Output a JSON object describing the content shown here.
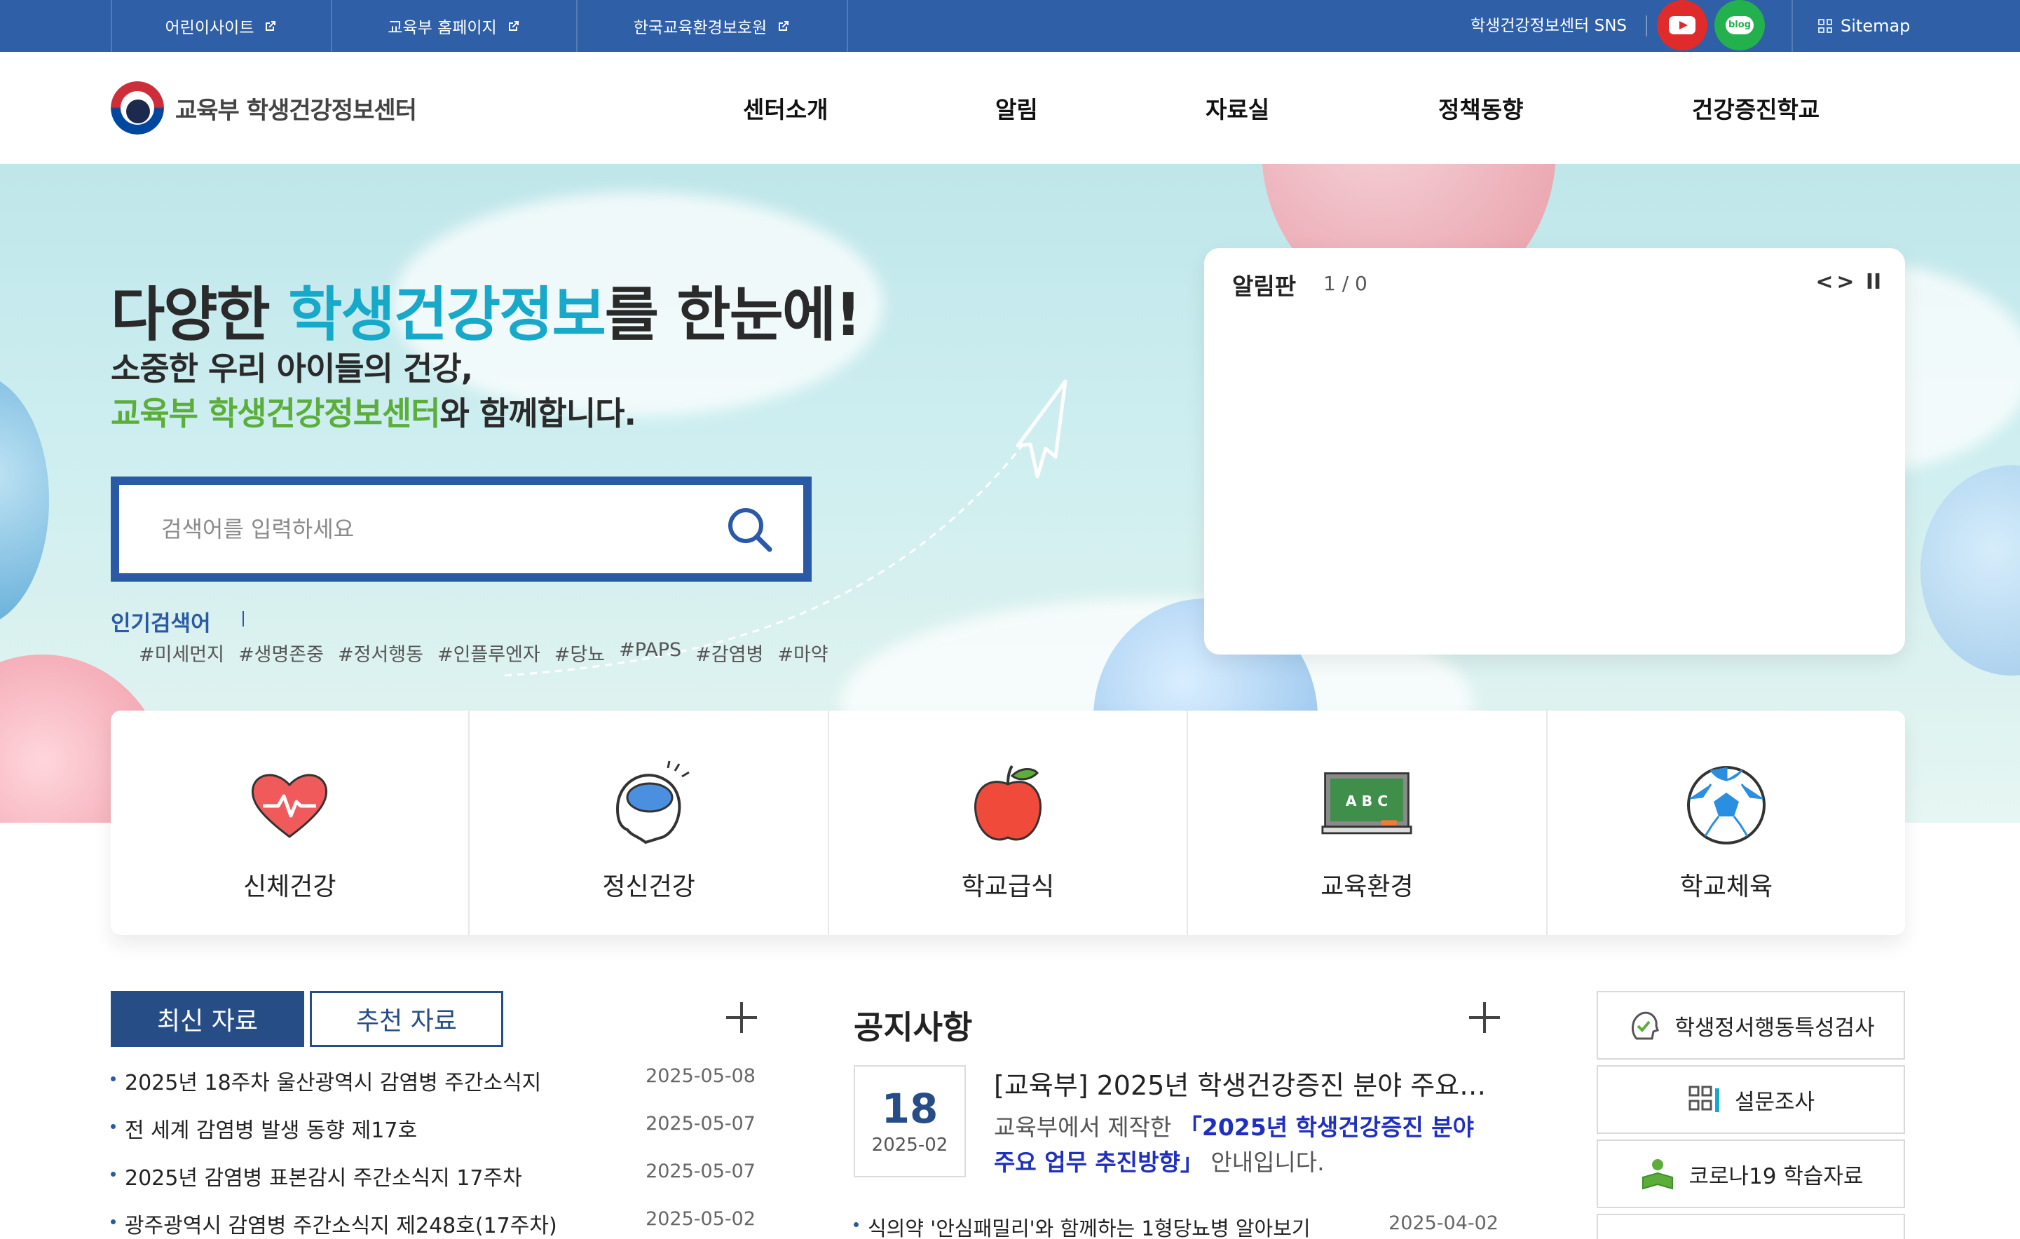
{
  "topbar": {
    "links": [
      {
        "label": "어린이사이트"
      },
      {
        "label": "교육부 홈페이지"
      },
      {
        "label": "한국교육환경보호원"
      }
    ],
    "sns_label": "학생건강정보센터 SNS",
    "youtube_icon": "youtube-icon",
    "blog_label": "blog",
    "sitemap_label": "Sitemap"
  },
  "header": {
    "logo_text": "교육부 학생건강정보센터",
    "nav": [
      "센터소개",
      "알림",
      "자료실",
      "정책동향",
      "건강증진학교"
    ]
  },
  "hero": {
    "title_pre": "다양한 ",
    "title_hl": "학생건강정보",
    "title_post": "를 한눈에!",
    "sub1": "소중한 우리 아이들의 건강,",
    "sub2_hl": "교육부 학생건강정보센터",
    "sub2_post": "와 함께합니다.",
    "search_placeholder": "검색어를 입력하세요",
    "popular_label": "인기검색어",
    "popular_tags": [
      "#미세먼지",
      "#생명존중",
      "#정서행동",
      "#인플루엔자",
      "#당뇨",
      "#PAPS",
      "#감염병",
      "#마약"
    ]
  },
  "noticeboard": {
    "title": "알림판",
    "count": "1 / 0",
    "prev": "<",
    "next": ">",
    "pause": "II"
  },
  "categories": [
    {
      "label": "신체건강",
      "icon": "heart-icon"
    },
    {
      "label": "정신건강",
      "icon": "brain-icon"
    },
    {
      "label": "학교급식",
      "icon": "apple-icon"
    },
    {
      "label": "교육환경",
      "icon": "chalkboard-icon"
    },
    {
      "label": "학교체육",
      "icon": "soccer-ball-icon"
    }
  ],
  "resources": {
    "tab_latest": "최신 자료",
    "tab_recommended": "추천 자료",
    "items": [
      {
        "title": "2025년 18주차 울산광역시 감염병 주간소식지",
        "date": "2025-05-08"
      },
      {
        "title": "전 세계 감염병 발생 동향 제17호",
        "date": "2025-05-07"
      },
      {
        "title": "2025년 감염병 표본감시 주간소식지 17주차",
        "date": "2025-05-07"
      },
      {
        "title": "광주광역시 감염병 주간소식지 제248호(17주차)",
        "date": "2025-05-02"
      }
    ]
  },
  "notices": {
    "title": "공지사항",
    "featured": {
      "day": "18",
      "ym": "2025-02",
      "title": "[교육부] 2025년 학생건강증진 분야 주요업...",
      "desc_pre": "교육부에서 제작한 ",
      "desc_hl": "「2025년 학생건강증진 분야 주요 업무 추진방향」",
      "desc_post": " 안내입니다."
    },
    "items": [
      {
        "title": "식의약 '안심패밀리'와 함께하는 1형당뇨병 알아보기",
        "date": "2025-04-02"
      }
    ]
  },
  "quicklinks": [
    {
      "label": "학생정서행동특성검사",
      "icon": "check-head-icon"
    },
    {
      "label": "설문조사",
      "icon": "survey-icon"
    },
    {
      "label": "코로나19 학습자료",
      "icon": "book-person-icon"
    }
  ],
  "colors": {
    "topbar": "#2f5fa6",
    "accent_blue": "#264d85",
    "accent_cyan": "#17a9c9",
    "accent_green": "#5cae3a",
    "highlight_text": "#1f2fbf"
  }
}
